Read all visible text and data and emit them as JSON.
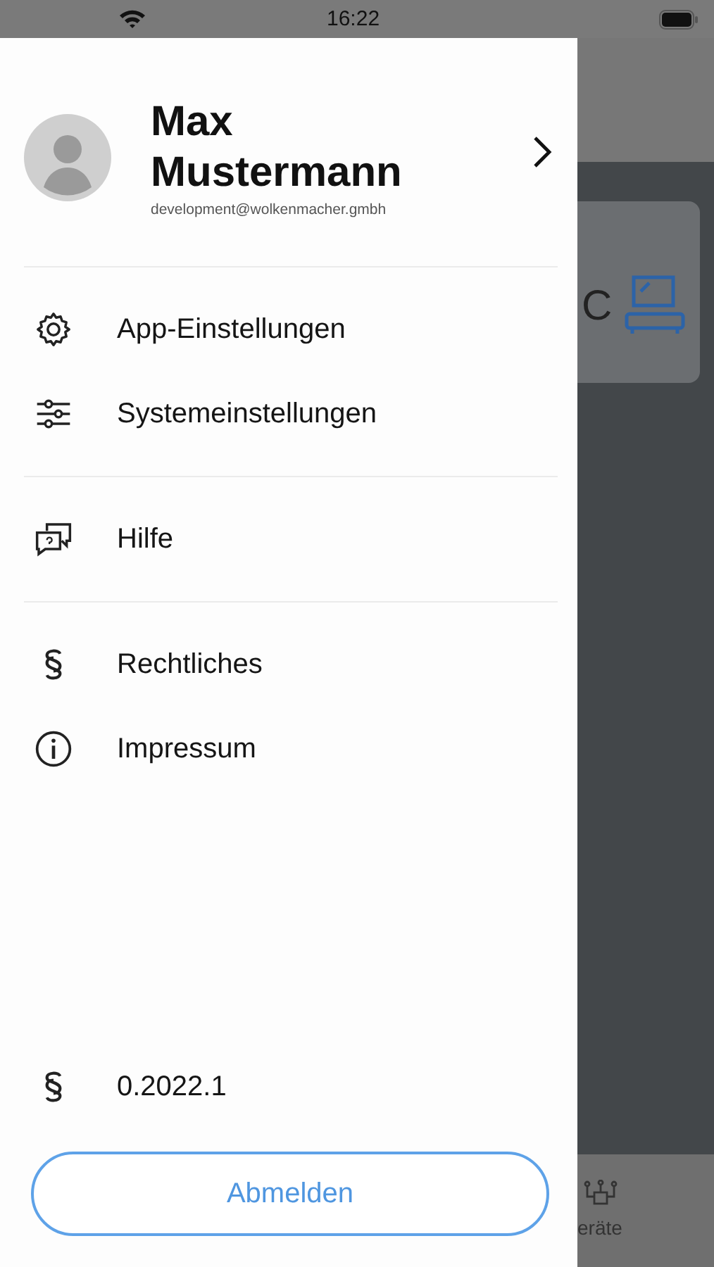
{
  "status_bar": {
    "time": "16:22"
  },
  "profile": {
    "name": "Max Mustermann",
    "email": "development@wolkenmacher.gmbh"
  },
  "menu_sections": [
    [
      {
        "kind": "gear",
        "label": "App-Einstellungen"
      },
      {
        "kind": "sliders",
        "label": "Systemeinstellungen"
      }
    ],
    [
      {
        "kind": "help",
        "label": "Hilfe"
      }
    ],
    [
      {
        "kind": "section",
        "label": "Rechtliches"
      },
      {
        "kind": "info",
        "label": "Impressum"
      }
    ]
  ],
  "version": {
    "kind": "section",
    "label": "0.2022.1"
  },
  "logout_button": "Abmelden",
  "background": {
    "card_text": "C",
    "tab_label": "eräte"
  }
}
